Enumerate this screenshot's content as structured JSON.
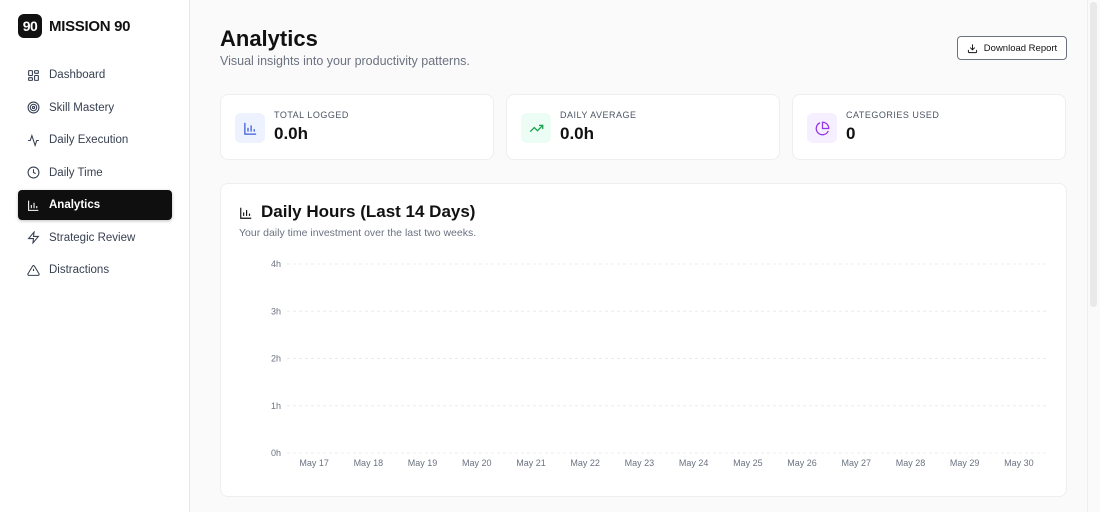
{
  "brand": {
    "logo": "90",
    "name": "MISSION 90"
  },
  "nav": [
    {
      "label": "Dashboard",
      "icon": "grid-icon",
      "active": false
    },
    {
      "label": "Skill Mastery",
      "icon": "target-icon",
      "active": false
    },
    {
      "label": "Daily Execution",
      "icon": "activity-icon",
      "active": false
    },
    {
      "label": "Daily Time",
      "icon": "clock-icon",
      "active": false
    },
    {
      "label": "Analytics",
      "icon": "bar-chart-icon",
      "active": true
    },
    {
      "label": "Strategic Review",
      "icon": "zap-icon",
      "active": false
    },
    {
      "label": "Distractions",
      "icon": "warning-icon",
      "active": false
    }
  ],
  "header": {
    "title": "Analytics",
    "subtitle": "Visual insights into your productivity patterns.",
    "download_label": "Download Report"
  },
  "stats": [
    {
      "label": "TOTAL LOGGED",
      "value": "0.0h",
      "icon": "bar-chart-icon",
      "color": "#3b5bdb",
      "bg": "#eef2ff"
    },
    {
      "label": "DAILY AVERAGE",
      "value": "0.0h",
      "icon": "trending-up-icon",
      "color": "#16a34a",
      "bg": "#ecfdf5"
    },
    {
      "label": "CATEGORIES USED",
      "value": "0",
      "icon": "pie-chart-icon",
      "color": "#9333ea",
      "bg": "#f5efff"
    }
  ],
  "chart": {
    "title": "Daily Hours (Last 14 Days)",
    "subtitle": "Your daily time investment over the last two weeks."
  },
  "chart_data": {
    "type": "bar",
    "title": "Daily Hours (Last 14 Days)",
    "xlabel": "",
    "ylabel": "",
    "categories": [
      "May 17",
      "May 18",
      "May 19",
      "May 20",
      "May 21",
      "May 22",
      "May 23",
      "May 24",
      "May 25",
      "May 26",
      "May 27",
      "May 28",
      "May 29",
      "May 30"
    ],
    "values": [
      0,
      0,
      0,
      0,
      0,
      0,
      0,
      0,
      0,
      0,
      0,
      0,
      0,
      0
    ],
    "y_ticks": [
      "0h",
      "1h",
      "2h",
      "3h",
      "4h"
    ],
    "ylim": [
      0,
      4
    ],
    "grid": true
  }
}
